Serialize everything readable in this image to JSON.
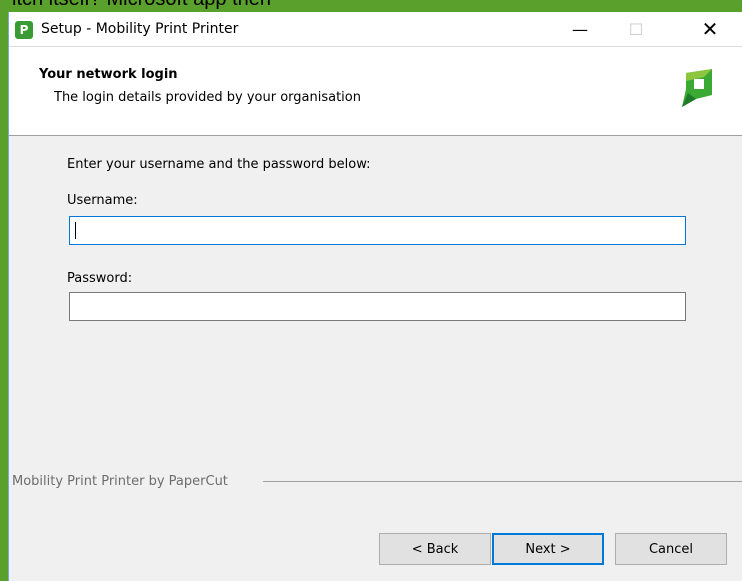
{
  "background": {
    "partial_text": "itch itself? Microsoft app then"
  },
  "window": {
    "title": "Setup - Mobility Print Printer",
    "app_icon_letter": "P",
    "controls": {
      "minimize": "—",
      "maximize": "☐",
      "close": "✕"
    }
  },
  "header": {
    "title": "Your network login",
    "subtitle": "The login details provided by your organisation"
  },
  "form": {
    "prompt": "Enter your username and the password below:",
    "username_label": "Username:",
    "username_value": "",
    "password_label": "Password:",
    "password_value": ""
  },
  "footer": {
    "branding": "Mobility Print Printer by PaperCut"
  },
  "buttons": {
    "back": "< Back",
    "next": "Next >",
    "cancel": "Cancel"
  },
  "colors": {
    "accent": "#0078d7",
    "brand_green": "#3a9b34",
    "background_green": "#5aa02c"
  }
}
